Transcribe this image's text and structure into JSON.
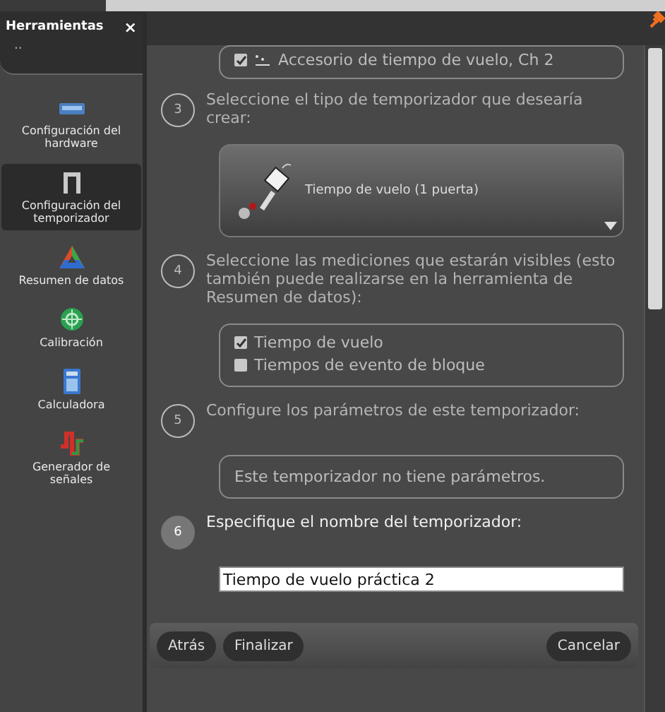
{
  "sidebar": {
    "title": "Herramientas",
    "close": "×",
    "handle": "··",
    "items": [
      {
        "label": "Configuración del hardware",
        "kind": "hardware",
        "selected": false
      },
      {
        "label": "Configuración del temporizador",
        "kind": "timer",
        "selected": true
      },
      {
        "label": "Resumen de datos",
        "kind": "summary",
        "selected": false
      },
      {
        "label": "Calibración",
        "kind": "calibration",
        "selected": false
      },
      {
        "label": "Calculadora",
        "kind": "calculator",
        "selected": false
      },
      {
        "label": "Generador de señales",
        "kind": "signal",
        "selected": false
      }
    ]
  },
  "sensor": {
    "label": "Accesorio de tiempo de vuelo, Ch 2",
    "checked": true
  },
  "steps": [
    {
      "number": "3",
      "text": "Seleccione el tipo de temporizador que desearía crear:",
      "active": false,
      "kind": "selector",
      "value": "Tiempo de vuelo (1 puerta)"
    },
    {
      "number": "4",
      "text": "Seleccione las mediciones que estarán visibles (esto también puede realizarse en la herramienta de Resumen de datos):",
      "active": false,
      "kind": "checklist",
      "options": [
        {
          "label": "Tiempo de vuelo",
          "checked": true
        },
        {
          "label": "Tiempos de evento de bloque",
          "checked": false
        }
      ]
    },
    {
      "number": "5",
      "text": "Configure los parámetros de este temporizador:",
      "active": false,
      "kind": "note",
      "value": "Este temporizador no tiene parámetros."
    },
    {
      "number": "6",
      "text": "Especifique el nombre del temporizador:",
      "active": true,
      "kind": "input",
      "value": "Tiempo de vuelo práctica 2"
    }
  ],
  "buttons_left": [
    "Atrás",
    "Finalizar"
  ],
  "buttons_right": [
    "Cancelar"
  ]
}
